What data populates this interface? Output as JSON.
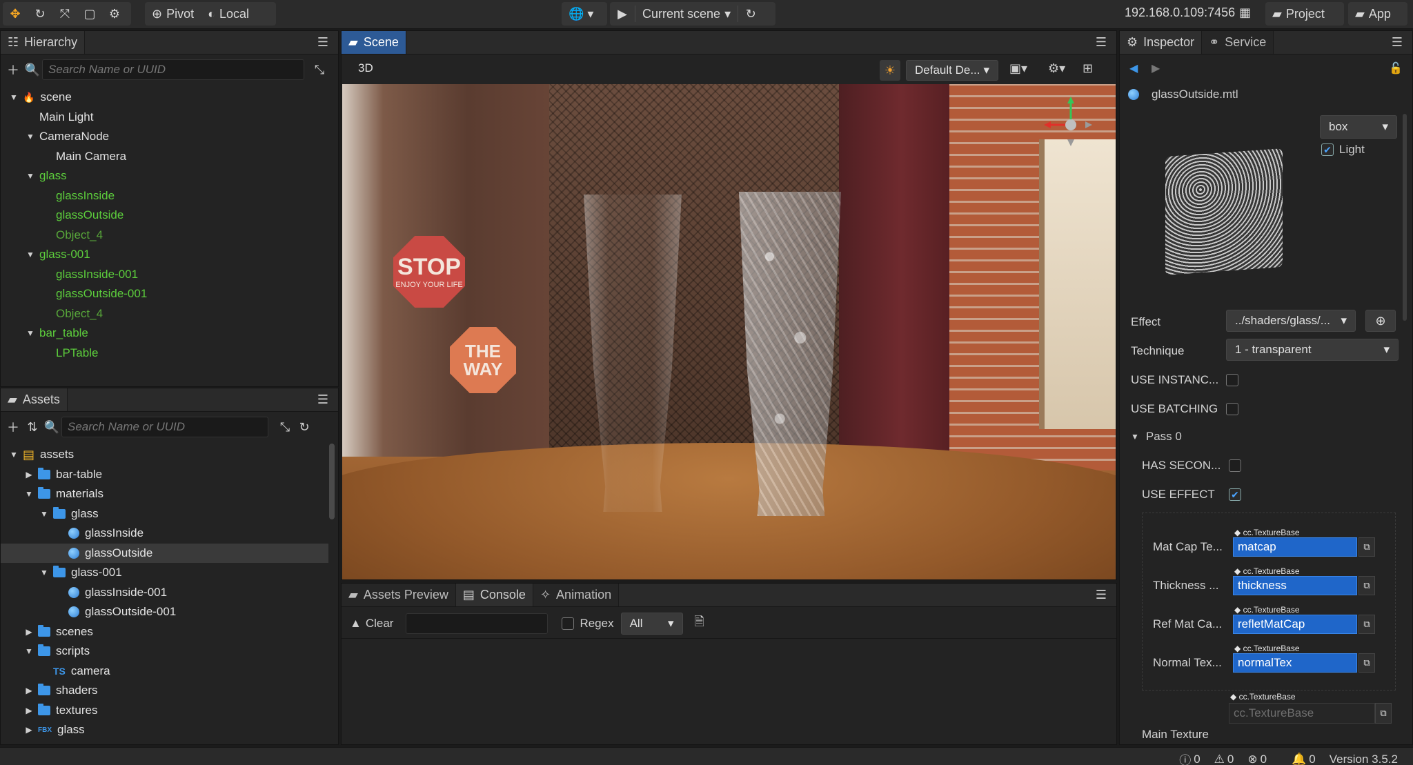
{
  "toolbar": {
    "pivot_label": "Pivot",
    "local_label": "Local",
    "scene_select": "Current scene",
    "ip_address": "192.168.0.109:7456",
    "project_label": "Project",
    "app_label": "App"
  },
  "hierarchy": {
    "tab_label": "Hierarchy",
    "search_placeholder": "Search Name or UUID",
    "nodes": [
      {
        "label": "scene",
        "depth": 0,
        "expanded": true,
        "style": "normal"
      },
      {
        "label": "Main Light",
        "depth": 1,
        "style": "normal"
      },
      {
        "label": "CameraNode",
        "depth": 1,
        "expanded": true,
        "style": "normal"
      },
      {
        "label": "Main Camera",
        "depth": 2,
        "style": "normal"
      },
      {
        "label": "glass",
        "depth": 1,
        "expanded": true,
        "style": "green"
      },
      {
        "label": "glassInside",
        "depth": 2,
        "style": "green"
      },
      {
        "label": "glassOutside",
        "depth": 2,
        "style": "green"
      },
      {
        "label": "Object_4",
        "depth": 2,
        "style": "dim-green"
      },
      {
        "label": "glass-001",
        "depth": 1,
        "expanded": true,
        "style": "green"
      },
      {
        "label": "glassInside-001",
        "depth": 2,
        "style": "green"
      },
      {
        "label": "glassOutside-001",
        "depth": 2,
        "style": "green"
      },
      {
        "label": "Object_4",
        "depth": 2,
        "style": "dim-green"
      },
      {
        "label": "bar_table",
        "depth": 1,
        "expanded": true,
        "style": "green"
      },
      {
        "label": "LPTable",
        "depth": 2,
        "style": "green"
      }
    ]
  },
  "assets": {
    "tab_label": "Assets",
    "search_placeholder": "Search Name or UUID",
    "items": [
      {
        "label": "assets",
        "depth": 0,
        "expanded": true,
        "icon": "db"
      },
      {
        "label": "bar-table",
        "depth": 1,
        "expanded": false,
        "icon": "folder"
      },
      {
        "label": "materials",
        "depth": 1,
        "expanded": true,
        "icon": "folder"
      },
      {
        "label": "glass",
        "depth": 2,
        "expanded": true,
        "icon": "folder"
      },
      {
        "label": "glassInside",
        "depth": 3,
        "icon": "mtl"
      },
      {
        "label": "glassOutside",
        "depth": 3,
        "icon": "mtl",
        "selected": true
      },
      {
        "label": "glass-001",
        "depth": 2,
        "expanded": true,
        "icon": "folder"
      },
      {
        "label": "glassInside-001",
        "depth": 3,
        "icon": "mtl"
      },
      {
        "label": "glassOutside-001",
        "depth": 3,
        "icon": "mtl"
      },
      {
        "label": "scenes",
        "depth": 1,
        "expanded": false,
        "icon": "folder"
      },
      {
        "label": "scripts",
        "depth": 1,
        "expanded": true,
        "icon": "folder"
      },
      {
        "label": "camera",
        "depth": 2,
        "icon": "ts"
      },
      {
        "label": "shaders",
        "depth": 1,
        "expanded": false,
        "icon": "folder"
      },
      {
        "label": "textures",
        "depth": 1,
        "expanded": false,
        "icon": "folder"
      },
      {
        "label": "glass",
        "depth": 1,
        "expanded": false,
        "icon": "fbx"
      }
    ]
  },
  "scene": {
    "tab_label": "Scene",
    "mode_label": "3D",
    "layout_select": "Default De...",
    "sign_stop": "STOP",
    "sign_stop_small": "ENJOY YOUR LIFE",
    "sign_way": "THE WAY"
  },
  "bottom": {
    "tabs": [
      "Assets Preview",
      "Console",
      "Animation"
    ],
    "clear_label": "Clear",
    "regex_label": "Regex",
    "filter_select": "All"
  },
  "inspector": {
    "tabs": [
      "Inspector",
      "Service"
    ],
    "asset_name": "glassOutside.mtl",
    "preview_shape": "box",
    "light_label": "Light",
    "effect_label": "Effect",
    "effect_value": "../shaders/glass/...",
    "technique_label": "Technique",
    "technique_value": "1 - transparent",
    "use_instancing": "USE INSTANC...",
    "use_batching": "USE BATCHING",
    "pass_label": "Pass 0",
    "has_second": "HAS SECON...",
    "use_effect": "USE EFFECT",
    "texture_type": "cc.TextureBase",
    "textures": [
      {
        "label": "Mat Cap Te...",
        "value": "matcap"
      },
      {
        "label": "Thickness ...",
        "value": "thickness"
      },
      {
        "label": "Ref Mat Ca...",
        "value": "refletMatCap"
      },
      {
        "label": "Normal Tex...",
        "value": "normalTex"
      }
    ],
    "main_texture_label": "Main Texture",
    "main_texture_placeholder": "cc.TextureBase"
  },
  "status": {
    "info_count": "0",
    "warn_count": "0",
    "error_count": "0",
    "bell_count": "0",
    "version": "Version 3.5.2"
  }
}
